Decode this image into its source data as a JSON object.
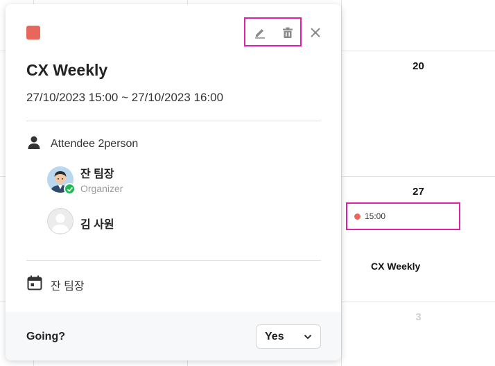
{
  "calendar": {
    "day_20": "20",
    "day_27": "27",
    "day_3": "3",
    "event": {
      "time": "15:00",
      "title": "CX Weekly",
      "color": "#e8675a"
    }
  },
  "popup": {
    "color": "#e8675a",
    "title": "CX Weekly",
    "datetime": "27/10/2023 15:00 ~ 27/10/2023 16:00",
    "attendee_label": "Attendee 2person",
    "attendees": [
      {
        "name": "잔 팀장",
        "role": "Organizer",
        "avatar": "organizer-photo",
        "status": "accepted"
      },
      {
        "name": "김 사원",
        "role": "",
        "avatar": "default-avatar"
      }
    ],
    "calendar_owner": "잔 팀장",
    "icons": {
      "edit": "pencil-icon",
      "delete": "trash-icon",
      "close": "close-icon",
      "person": "person-icon",
      "calendar": "calendar-icon",
      "dropdown": "chevron-down-icon"
    },
    "footer": {
      "going_label": "Going?",
      "going_value": "Yes"
    },
    "highlight_color": "#e21fa6"
  }
}
